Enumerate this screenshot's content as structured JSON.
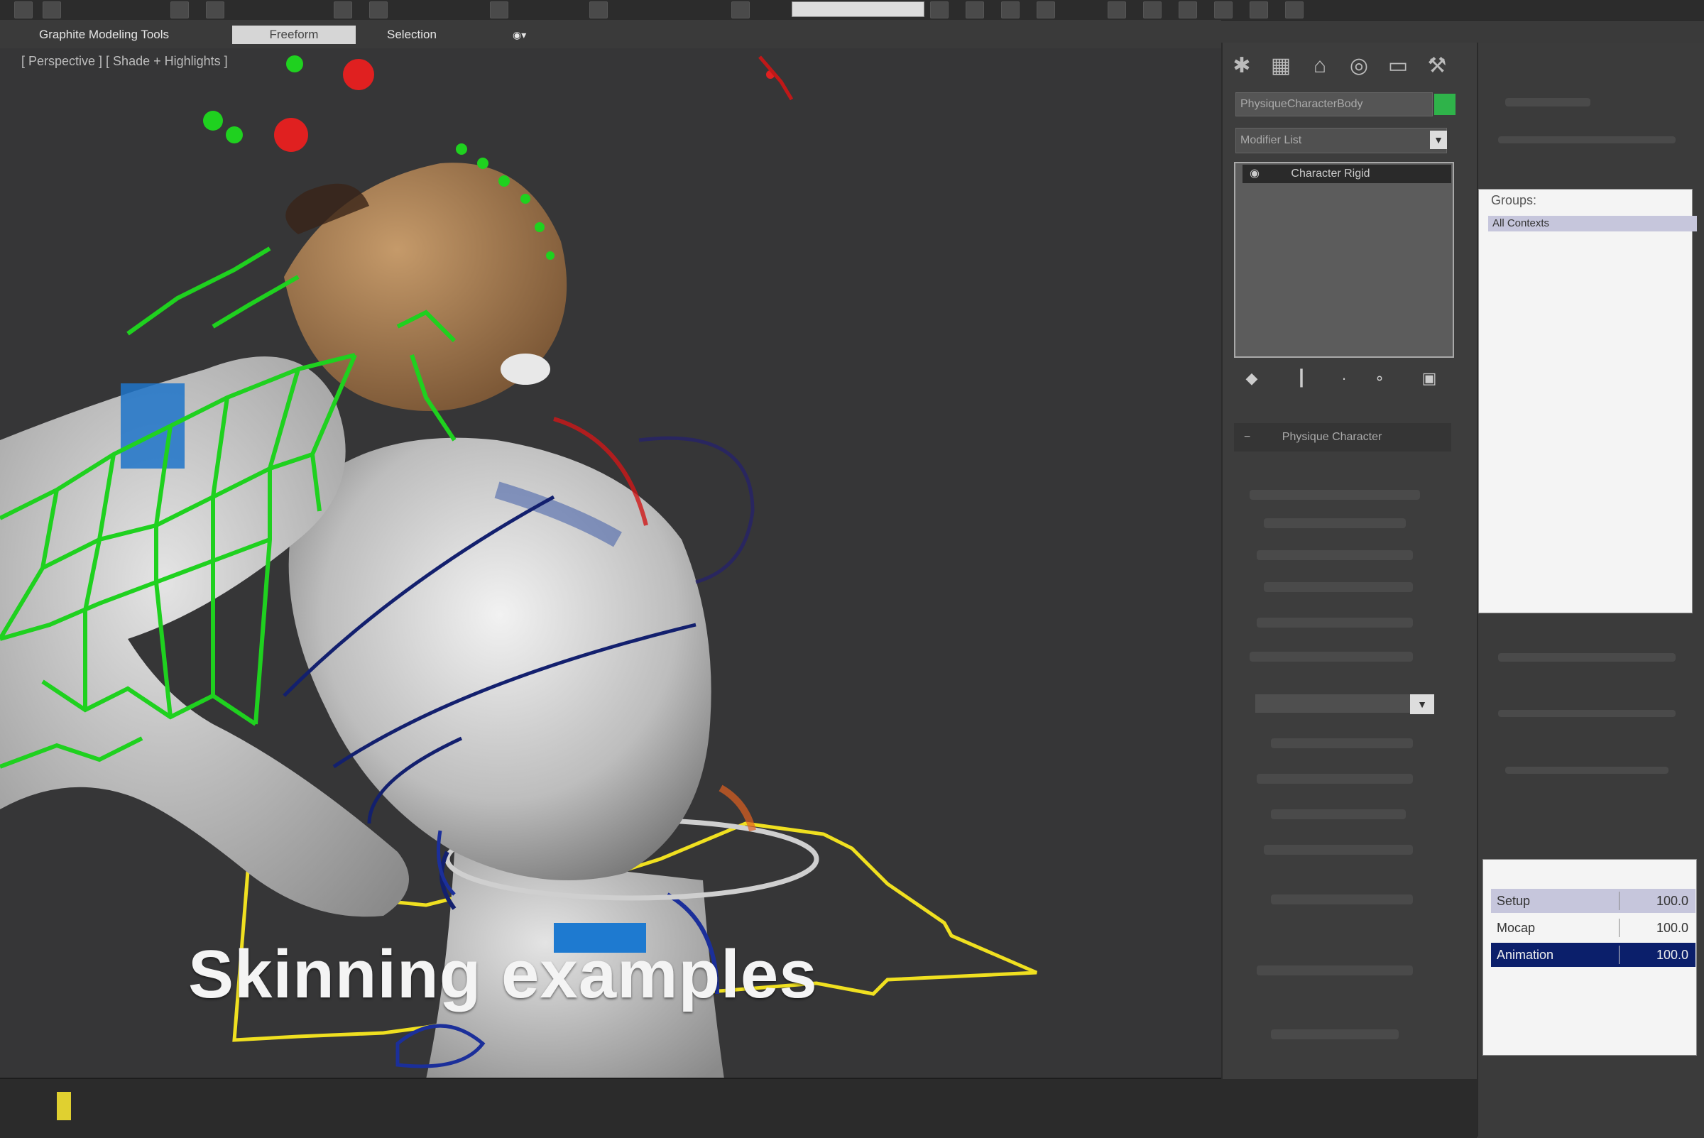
{
  "ribbon": {
    "tabs": [
      {
        "label": "Graphite Modeling Tools"
      },
      {
        "label": "Freeform"
      },
      {
        "label": "Selection"
      }
    ]
  },
  "viewport": {
    "label": "[ Perspective ] [ Shade + Highlights ]",
    "caption": "Skinning examples"
  },
  "command_panel": {
    "object_name": "PhysiqueCharacterBody",
    "modifier_list": "Modifier List",
    "stack_item": "Character Rigid",
    "rollout_title": "Physique Character",
    "name_color": "#2fb34a"
  },
  "groups_panel": {
    "label": "Groups:",
    "selected_row": "All Contexts"
  },
  "layers_panel": {
    "rows": [
      {
        "name": "Setup",
        "value": "100.0"
      },
      {
        "name": "Mocap",
        "value": "100.0"
      },
      {
        "name": "Animation",
        "value": "100.0"
      }
    ]
  },
  "colors": {
    "accent_green": "#2fb34a",
    "selection_blue": "#0b1f6b",
    "mesh_white": "#e8e8e8",
    "spline_yellow": "#f0e020",
    "spline_green": "#1fd11f"
  }
}
